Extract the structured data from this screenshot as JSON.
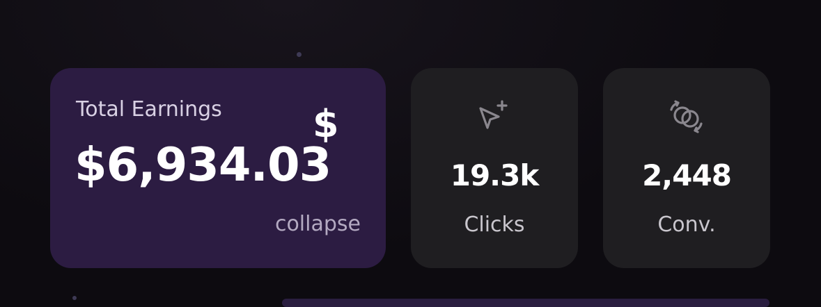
{
  "earnings": {
    "label": "Total Earnings",
    "value": "$6,934.03",
    "currency_symbol": "$",
    "collapse_label": "collapse"
  },
  "stats": [
    {
      "value": "19.3k",
      "label": "Clicks",
      "icon": "cursor-plus-icon"
    },
    {
      "value": "2,448",
      "label": "Conv.",
      "icon": "conversion-circles-icon"
    }
  ],
  "colors": {
    "earnings_card": "#2c1c42",
    "stat_card": "#1f1e21",
    "background": "#0d0b10",
    "icon_gray": "#8a878e"
  }
}
